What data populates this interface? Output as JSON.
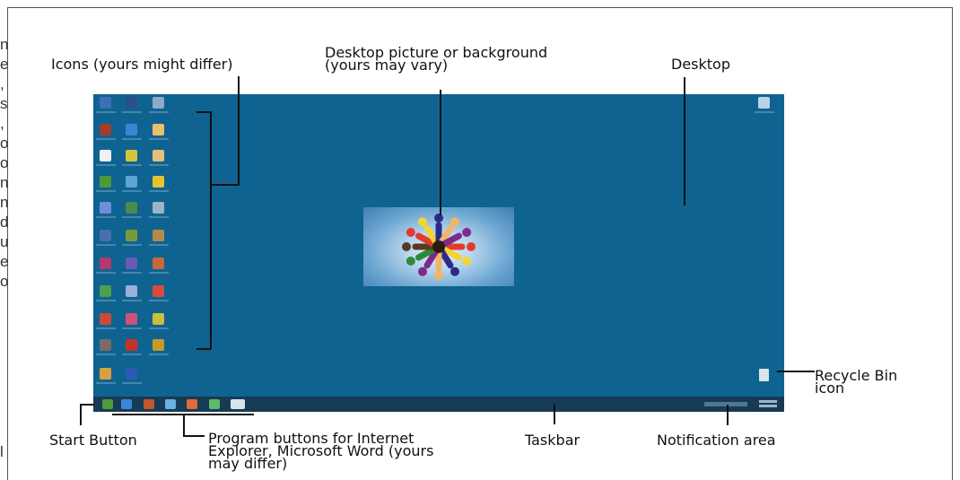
{
  "labels": {
    "icons": "Icons (yours might differ)",
    "background_line1": "Desktop picture or background",
    "background_line2": "(yours may vary)",
    "desktop": "Desktop",
    "recycle_line1": "Recycle Bin",
    "recycle_line2": "icon",
    "start": "Start Button",
    "program_line1": "Program buttons for Internet",
    "program_line2": "Explorer, Microsoft Word (yours",
    "program_line3": "may differ)",
    "taskbar": "Taskbar",
    "notification": "Notification area"
  },
  "edge_letters": [
    "n",
    "e",
    ",",
    "s",
    ",",
    "o",
    "o",
    "n",
    "n",
    "d",
    "u",
    "e",
    "o",
    "l"
  ],
  "colors": {
    "desktop": "#0f6390",
    "taskbar": "#173b55",
    "figures": [
      "#e23b2e",
      "#f2d535",
      "#2e2a88",
      "#f0b56a",
      "#7d2a8c",
      "#2d8a3a",
      "#5a3a1f"
    ]
  },
  "desktop_icons": [
    {
      "name": "app-icon",
      "color": "#3b6fb6"
    },
    {
      "name": "app-icon",
      "color": "#2b4f8a"
    },
    {
      "name": "app-icon",
      "color": "#8fa9c9"
    },
    {
      "name": "app-icon",
      "color": "#a33d2a"
    },
    {
      "name": "ie-icon",
      "color": "#3a86d6"
    },
    {
      "name": "app-icon",
      "color": "#e8c26a"
    },
    {
      "name": "app-icon",
      "color": "#f0f0f0"
    },
    {
      "name": "app-icon",
      "color": "#d8c43a"
    },
    {
      "name": "app-icon",
      "color": "#e6c07a"
    },
    {
      "name": "app-icon",
      "color": "#4c9a3a"
    },
    {
      "name": "app-icon",
      "color": "#5ba5d8"
    },
    {
      "name": "check-icon",
      "color": "#e5c42f"
    },
    {
      "name": "app-icon",
      "color": "#6c8fd6"
    },
    {
      "name": "app-icon",
      "color": "#4c8a52"
    },
    {
      "name": "app-icon",
      "color": "#9cb3c8"
    },
    {
      "name": "app-icon",
      "color": "#4a6fae"
    },
    {
      "name": "app-icon",
      "color": "#7a9a3a"
    },
    {
      "name": "app-icon",
      "color": "#b48a4a"
    },
    {
      "name": "app-icon",
      "color": "#b33a6a"
    },
    {
      "name": "app-icon",
      "color": "#6a5ab8"
    },
    {
      "name": "app-icon",
      "color": "#c9683a"
    },
    {
      "name": "app-icon",
      "color": "#4f9e4a"
    },
    {
      "name": "app-icon",
      "color": "#9ab0d8"
    },
    {
      "name": "app-icon",
      "color": "#d94a3a"
    },
    {
      "name": "app-icon",
      "color": "#c84a3a"
    },
    {
      "name": "app-icon",
      "color": "#d0507a"
    },
    {
      "name": "app-icon",
      "color": "#c9c03a"
    },
    {
      "name": "app-icon",
      "color": "#7a6a6a"
    },
    {
      "name": "app-icon",
      "color": "#c8302a"
    },
    {
      "name": "app-icon",
      "color": "#c89a2a"
    },
    {
      "name": "app-icon",
      "color": "#d8a040"
    },
    {
      "name": "app-icon",
      "color": "#2a5ab8"
    }
  ],
  "taskbar_buttons": [
    {
      "name": "start-button-icon",
      "color": "#4f9a3a"
    },
    {
      "name": "ie-taskbar-icon",
      "color": "#3a86d6"
    },
    {
      "name": "app-taskbar-icon",
      "color": "#c2562e"
    },
    {
      "name": "app-taskbar-icon",
      "color": "#6ab0e0"
    },
    {
      "name": "app-taskbar-icon",
      "color": "#e06a3a"
    },
    {
      "name": "app-taskbar-icon",
      "color": "#5aba6a"
    },
    {
      "name": "app-taskbar-icon",
      "color": "#d8e4ea"
    }
  ]
}
